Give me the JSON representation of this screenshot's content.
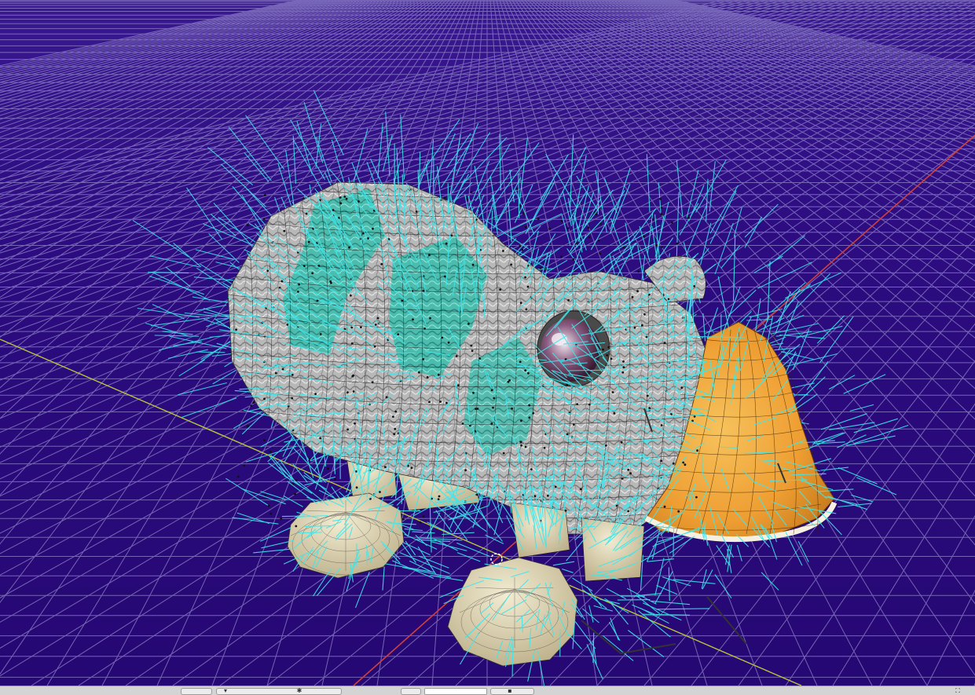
{
  "app": {
    "view": "3d-viewport",
    "shading": "textured",
    "overlay": "particle-hair-wireframe"
  },
  "colors": {
    "background": "#2a0a7a",
    "horizon": "#4a2a9c",
    "grid_line": "#8f84c8",
    "axis_x": "#d0403a",
    "axis_y": "#b9c640",
    "hair_strand": "#3ee6ec",
    "fur_gray": "#b4b4b4",
    "fur_teal": "#4fbfb0",
    "nose_orange": "#f0a63a",
    "foot_cream": "#e2d8b4",
    "eye_pink": "#c45c9c",
    "mesh_edge": "#1a1a1a",
    "toolbar_bg": "#d4d4d4"
  },
  "object": {
    "type": "mesh-with-hair-particles",
    "parts": [
      "body",
      "head",
      "nose",
      "eye",
      "legs",
      "feet",
      "hair-strands"
    ]
  },
  "toolbar": {
    "icons": [
      "view-menu-icon",
      "pivot-dropdown-icon",
      "mode-dropdown-icon",
      "layer-icon",
      "render-icon"
    ]
  }
}
